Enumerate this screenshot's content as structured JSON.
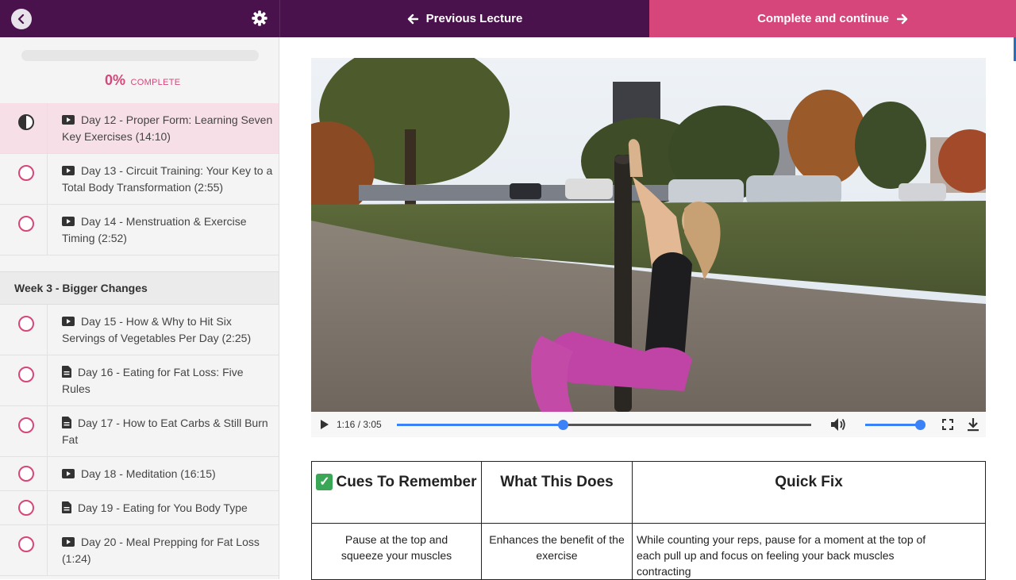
{
  "topbar": {
    "previous_label": "Previous Lecture",
    "complete_label": "Complete and continue",
    "colors": {
      "nav_bg": "#4a124c",
      "accent": "#d6467a"
    }
  },
  "progress": {
    "percent_text": "0%",
    "label": "COMPLETE",
    "value": 0
  },
  "sidebar": {
    "lectures_a": [
      {
        "icon": "video-icon",
        "title": "Day 12 - Proper Form: Learning Seven Key Exercises (14:10)",
        "status": "in-progress"
      },
      {
        "icon": "video-icon",
        "title": "Day 13 - Circuit Training: Your Key to a Total Body Transformation (2:55)",
        "status": "not-started"
      },
      {
        "icon": "video-icon",
        "title": "Day 14 - Menstruation & Exercise Timing (2:52)",
        "status": "not-started"
      }
    ],
    "section_title": "Week 3 - Bigger Changes",
    "lectures_b": [
      {
        "icon": "video-icon",
        "title": "Day 15 - How & Why to Hit Six Servings of Vegetables Per Day (2:25)"
      },
      {
        "icon": "document-icon",
        "title": "Day 16 - Eating for Fat Loss: Five Rules"
      },
      {
        "icon": "document-icon",
        "title": "Day 17 - How to Eat Carbs & Still Burn Fat"
      },
      {
        "icon": "video-icon",
        "title": "Day 18 - Meditation (16:15)"
      },
      {
        "icon": "document-icon",
        "title": "Day 19 - Eating for You Body Type"
      },
      {
        "icon": "video-icon",
        "title": "Day 20 - Meal Prepping for Fat Loss (1:24)"
      }
    ]
  },
  "player": {
    "time_text": "1:16 / 3:05",
    "played_fraction": 0.4,
    "volume_fraction": 1.0
  },
  "table": {
    "headers": [
      "Cues To Remember",
      "What This Does",
      "Quick Fix"
    ],
    "row": [
      "Pause at the top and squeeze your muscles",
      "Enhances the benefit of the exercise",
      "While counting your reps, pause for a moment at the top of each pull up and focus on feeling your back muscles contracting"
    ]
  }
}
